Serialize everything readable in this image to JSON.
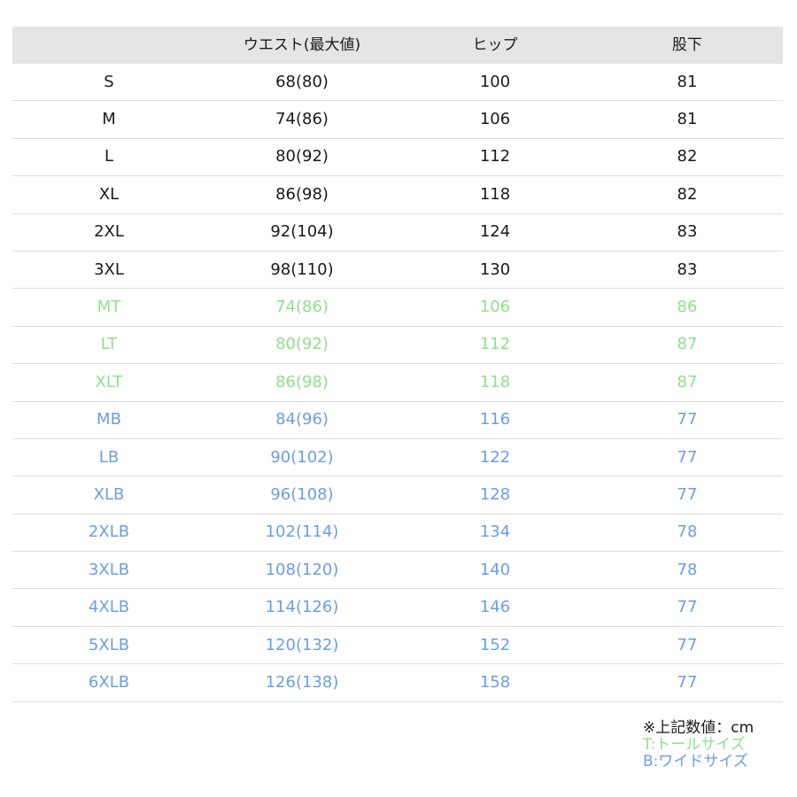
{
  "table": {
    "headers": [
      "",
      "ウエスト(最大値)",
      "ヒップ",
      "股下"
    ],
    "rows": [
      {
        "group": "standard",
        "cells": [
          "S",
          "68(80)",
          "100",
          "81"
        ]
      },
      {
        "group": "standard",
        "cells": [
          "M",
          "74(86)",
          "106",
          "81"
        ]
      },
      {
        "group": "standard",
        "cells": [
          "L",
          "80(92)",
          "112",
          "82"
        ]
      },
      {
        "group": "standard",
        "cells": [
          "XL",
          "86(98)",
          "118",
          "82"
        ]
      },
      {
        "group": "standard",
        "cells": [
          "2XL",
          "92(104)",
          "124",
          "83"
        ]
      },
      {
        "group": "standard",
        "cells": [
          "3XL",
          "98(110)",
          "130",
          "83"
        ]
      },
      {
        "group": "tall",
        "cells": [
          "MT",
          "74(86)",
          "106",
          "86"
        ]
      },
      {
        "group": "tall",
        "cells": [
          "LT",
          "80(92)",
          "112",
          "87"
        ]
      },
      {
        "group": "tall",
        "cells": [
          "XLT",
          "86(98)",
          "118",
          "87"
        ]
      },
      {
        "group": "wide",
        "cells": [
          "MB",
          "84(96)",
          "116",
          "77"
        ]
      },
      {
        "group": "wide",
        "cells": [
          "LB",
          "90(102)",
          "122",
          "77"
        ]
      },
      {
        "group": "wide",
        "cells": [
          "XLB",
          "96(108)",
          "128",
          "77"
        ]
      },
      {
        "group": "wide",
        "cells": [
          "2XLB",
          "102(114)",
          "134",
          "78"
        ]
      },
      {
        "group": "wide",
        "cells": [
          "3XLB",
          "108(120)",
          "140",
          "78"
        ]
      },
      {
        "group": "wide",
        "cells": [
          "4XLB",
          "114(126)",
          "146",
          "77"
        ]
      },
      {
        "group": "wide",
        "cells": [
          "5XLB",
          "120(132)",
          "152",
          "77"
        ]
      },
      {
        "group": "wide",
        "cells": [
          "6XLB",
          "126(138)",
          "158",
          "77"
        ]
      }
    ]
  },
  "notes": {
    "unit": "※上記数値：cm",
    "tall": "T:トールサイズ",
    "wide": "B:ワイドサイズ"
  },
  "colors": {
    "header_bg": "#e5e5e5",
    "standard_text": "#1a1a1a",
    "tall_text": "#8fe08c",
    "wide_text": "#6b9ee6",
    "row_divider": "#dcdcdc"
  }
}
